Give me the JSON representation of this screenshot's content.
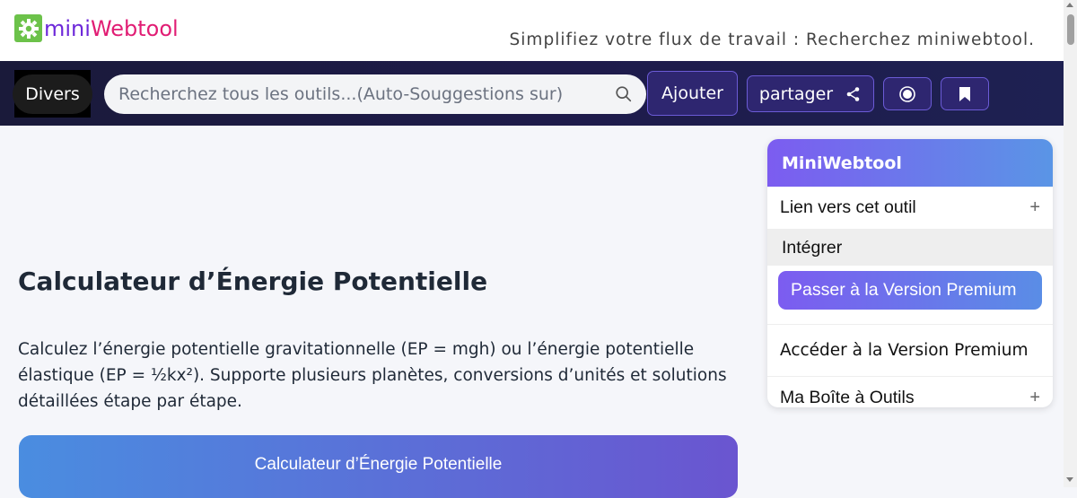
{
  "header": {
    "logo_mini": "mini",
    "logo_web": "Webtool",
    "tagline": "Simplifiez votre flux de travail : Recherchez miniwebtool."
  },
  "nav": {
    "divers_label": "Divers",
    "search_placeholder": "Recherchez tous les outils...(Auto-Souggestions sur)",
    "add_label": "Ajouter",
    "share_label": "partager"
  },
  "main": {
    "title": "Calculateur d’Énergie Potentielle",
    "description": "Calculez l’énergie potentielle gravitationnelle (EP = mgh) ou l’énergie potentielle élastique (EP = ½kx²). Supporte plusieurs planètes, conversions d’unités et solutions détaillées étape par étape.",
    "calc_card_title": "Calculateur d’Énergie Potentielle"
  },
  "sidebar": {
    "header": "MiniWebtool",
    "link_label": "Lien vers cet outil",
    "embed_label": "Intégrer",
    "premium_button": "Passer à la Version Premium",
    "access_premium": "Accéder à la Version Premium",
    "toolbox_label": "Ma Boîte à Outils",
    "plus_symbol": "+"
  },
  "colors": {
    "nav_bg": "#1e1b4b",
    "accent_purple": "#7c5cf0",
    "accent_blue": "#5a95e6",
    "logo_green": "#6cc24a",
    "logo_mini": "#6d28d9",
    "logo_web": "#e11d74"
  }
}
